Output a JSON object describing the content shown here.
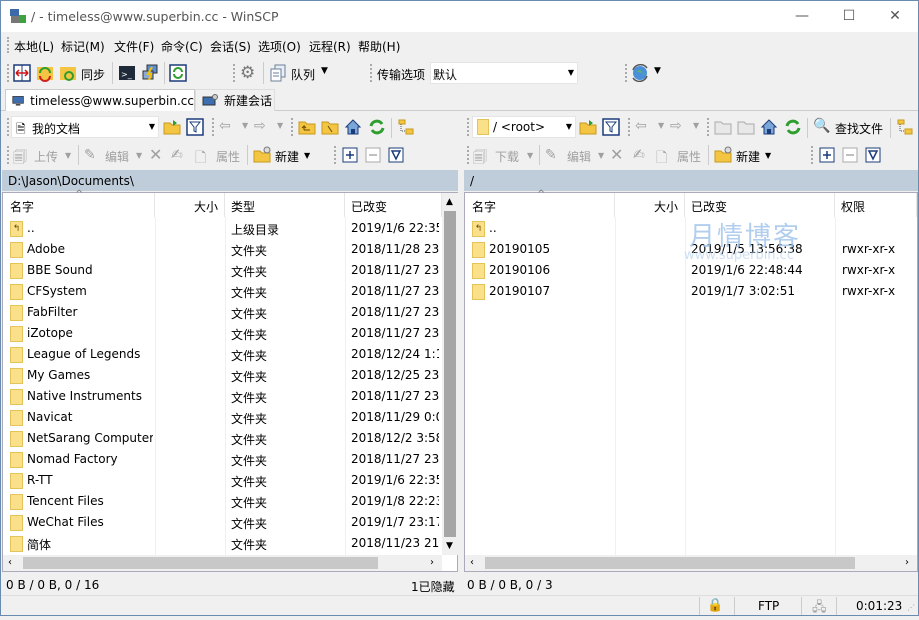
{
  "window": {
    "title": "/ - timeless@www.superbin.cc - WinSCP",
    "minimize": "—",
    "maximize": "☐",
    "close": "✕"
  },
  "menu": [
    "本地(L)",
    "标记(M)",
    "文件(F)",
    "命令(C)",
    "会话(S)",
    "选项(O)",
    "远程(R)",
    "帮助(H)"
  ],
  "toolbar": {
    "sync_label": "同步",
    "queue_label": "队列",
    "transfer_label": "传输选项",
    "transfer_value": "默认"
  },
  "tabs": [
    {
      "label": "timeless@www.superbin.cc"
    },
    {
      "label": "新建会话"
    }
  ],
  "left": {
    "location": "我的文档",
    "upload": "上传",
    "edit": "编辑",
    "properties": "属性",
    "new": "新建",
    "path": "D:\\Jason\\Documents\\",
    "columns": [
      "名字",
      "大小",
      "类型",
      "已改变"
    ],
    "rows": [
      {
        "name": "..",
        "type": "上级目录",
        "changed": "2019/1/6  22:35",
        "up": true
      },
      {
        "name": "Adobe",
        "type": "文件夹",
        "changed": "2018/11/28  23:"
      },
      {
        "name": "BBE Sound",
        "type": "文件夹",
        "changed": "2018/11/27  23:"
      },
      {
        "name": "CFSystem",
        "type": "文件夹",
        "changed": "2018/11/27  23:"
      },
      {
        "name": "FabFilter",
        "type": "文件夹",
        "changed": "2018/11/27  23:"
      },
      {
        "name": "iZotope",
        "type": "文件夹",
        "changed": "2018/11/27  23:"
      },
      {
        "name": "League of Legends",
        "type": "文件夹",
        "changed": "2018/12/24  1:1"
      },
      {
        "name": "My Games",
        "type": "文件夹",
        "changed": "2018/12/25  23:"
      },
      {
        "name": "Native Instruments",
        "type": "文件夹",
        "changed": "2018/11/27  23:"
      },
      {
        "name": "Navicat",
        "type": "文件夹",
        "changed": "2018/11/29  0:0"
      },
      {
        "name": "NetSarang Computer",
        "type": "文件夹",
        "changed": "2018/12/2  3:58"
      },
      {
        "name": "Nomad Factory",
        "type": "文件夹",
        "changed": "2018/11/27  23:"
      },
      {
        "name": "R-TT",
        "type": "文件夹",
        "changed": "2019/1/6  22:35"
      },
      {
        "name": "Tencent Files",
        "type": "文件夹",
        "changed": "2019/1/8  22:23"
      },
      {
        "name": "WeChat Files",
        "type": "文件夹",
        "changed": "2019/1/7  23:17"
      },
      {
        "name": "简体",
        "type": "文件夹",
        "changed": "2018/11/23  21:"
      }
    ],
    "status": "0 B / 0 B,  0 / 16",
    "hidden": "1已隐藏"
  },
  "right": {
    "location": "/ <root>",
    "download": "下载",
    "edit": "编辑",
    "properties": "属性",
    "new": "新建",
    "find": "查找文件",
    "path": "/",
    "columns": [
      "名字",
      "大小",
      "已改变",
      "权限"
    ],
    "rows": [
      {
        "name": "..",
        "changed": "",
        "rights": "",
        "up": true
      },
      {
        "name": "20190105",
        "changed": "2019/1/5 13:56:38",
        "rights": "rwxr-xr-x"
      },
      {
        "name": "20190106",
        "changed": "2019/1/6 22:48:44",
        "rights": "rwxr-xr-x"
      },
      {
        "name": "20190107",
        "changed": "2019/1/7 3:02:51",
        "rights": "rwxr-xr-x"
      }
    ],
    "status": "0 B / 0 B,  0 / 3"
  },
  "statusbar": {
    "protocol": "FTP",
    "elapsed": "0:01:23"
  },
  "watermark": {
    "cn": "月情博客",
    "url": "www.superbin.cc"
  }
}
